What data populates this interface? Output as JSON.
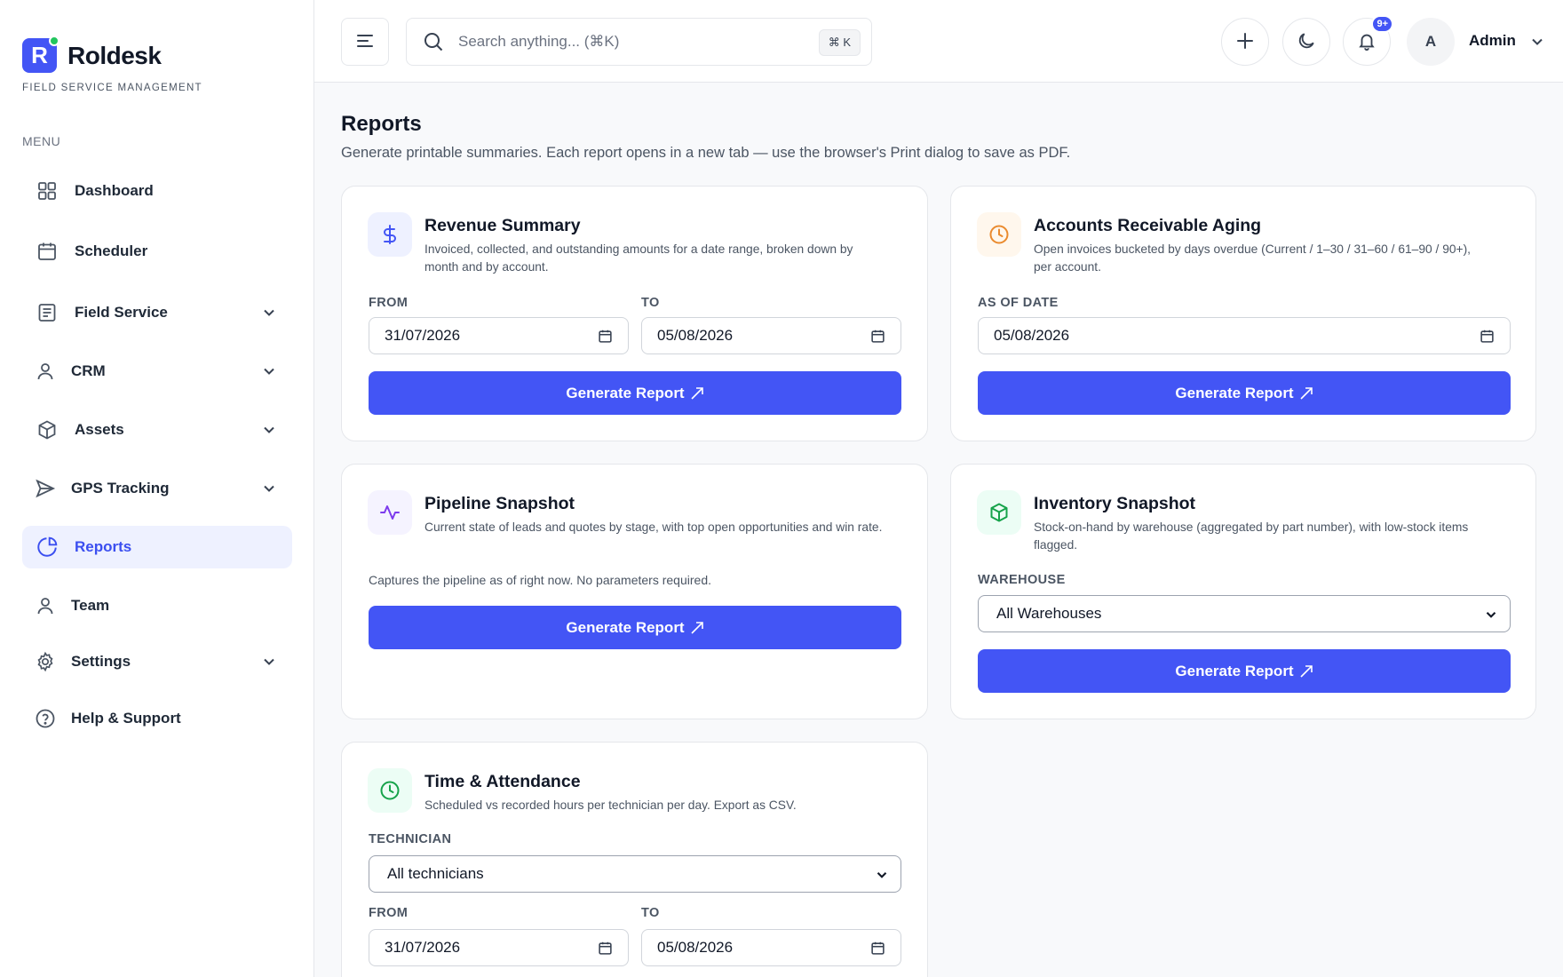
{
  "brand": {
    "logo_letter": "R",
    "name": "Roldesk",
    "subtitle": "FIELD SERVICE MANAGEMENT",
    "accent": "#4355f5"
  },
  "sidebar": {
    "menu_title": "MENU",
    "items": [
      {
        "label": "Dashboard",
        "icon": "grid-icon",
        "expandable": false
      },
      {
        "label": "Scheduler",
        "icon": "calendar-icon",
        "expandable": false
      },
      {
        "label": "Field Service",
        "icon": "document-icon",
        "expandable": true
      },
      {
        "label": "CRM",
        "icon": "user-icon",
        "expandable": true
      },
      {
        "label": "Assets",
        "icon": "box-icon",
        "expandable": true
      },
      {
        "label": "GPS Tracking",
        "icon": "send-icon",
        "expandable": true
      },
      {
        "label": "Reports",
        "icon": "pie-chart-icon",
        "expandable": false,
        "active": true
      },
      {
        "label": "Team",
        "icon": "user-icon",
        "expandable": false
      },
      {
        "label": "Settings",
        "icon": "gear-icon",
        "expandable": true
      },
      {
        "label": "Help & Support",
        "icon": "help-icon",
        "expandable": false
      }
    ]
  },
  "topbar": {
    "search_placeholder": "Search anything... (⌘K)",
    "search_shortcut": "⌘ K",
    "notification_badge": "9+",
    "avatar_initial": "A",
    "user_name": "Admin"
  },
  "page": {
    "title": "Reports",
    "subtitle": "Generate printable summaries. Each report opens in a new tab — use the browser's Print dialog to save as PDF."
  },
  "cards": {
    "revenue": {
      "title": "Revenue Summary",
      "desc": "Invoiced, collected, and outstanding amounts for a date range, broken down by month and by account.",
      "from_label": "FROM",
      "from_value": "31/07/2026",
      "to_label": "TO",
      "to_value": "05/08/2026",
      "button": "Generate Report"
    },
    "ar": {
      "title": "Accounts Receivable Aging",
      "desc": "Open invoices bucketed by days overdue (Current / 1–30 / 31–60 / 61–90 / 90+), per account.",
      "date_label": "AS OF DATE",
      "date_value": "05/08/2026",
      "button": "Generate Report"
    },
    "pipeline": {
      "title": "Pipeline Snapshot",
      "desc": "Current state of leads and quotes by stage, with top open opportunities and win rate.",
      "note": "Captures the pipeline as of right now. No parameters required.",
      "button": "Generate Report"
    },
    "inventory": {
      "title": "Inventory Snapshot",
      "desc": "Stock-on-hand by warehouse (aggregated by part number), with low-stock items flagged.",
      "warehouse_label": "WAREHOUSE",
      "warehouse_value": "All Warehouses",
      "button": "Generate Report"
    },
    "time": {
      "title": "Time & Attendance",
      "desc": "Scheduled vs recorded hours per technician per day. Export as CSV.",
      "tech_label": "TECHNICIAN",
      "tech_value": "All technicians",
      "from_label": "FROM",
      "from_value": "31/07/2026",
      "to_label": "TO",
      "to_value": "05/08/2026"
    }
  }
}
